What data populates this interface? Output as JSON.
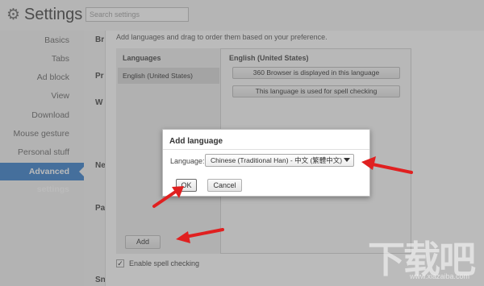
{
  "app": {
    "title": "Settings",
    "icon": "gear-icon",
    "search_placeholder": "Search settings"
  },
  "sidebar": {
    "items": [
      {
        "label": "Basics"
      },
      {
        "label": "Tabs"
      },
      {
        "label": "Ad block"
      },
      {
        "label": "View"
      },
      {
        "label": "Download"
      },
      {
        "label": "Mouse gesture"
      },
      {
        "label": "Personal stuff"
      },
      {
        "label": "Advanced settings",
        "active": true
      }
    ]
  },
  "section_labels": [
    "Br",
    "Pr",
    "W",
    "Ne",
    "Pa",
    "Sn"
  ],
  "languages_panel": {
    "intro": "Add languages and drag to order them based on your preference.",
    "list_header": "Languages",
    "list_items": [
      "English (United States)"
    ],
    "detail_header": "English (United States)",
    "display_button": "360 Browser is displayed in this language",
    "spell_button": "This language is used for spell checking",
    "add_button": "Add",
    "spell_checkbox_label": "Enable spell checking",
    "spell_checked": true
  },
  "dialog": {
    "title": "Add language",
    "language_label": "Language:",
    "selected_language": "Chinese (Traditional Han) - 中文 (繁體中文)",
    "ok_label": "OK",
    "cancel_label": "Cancel"
  },
  "annotation_color": "#e02020",
  "watermark": {
    "logo_text": "下载吧",
    "url": "www.xiazaiba.com"
  }
}
